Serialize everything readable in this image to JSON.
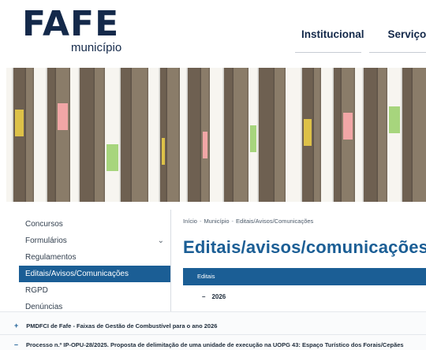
{
  "brand": {
    "name": "FAFE",
    "sub": "município"
  },
  "nav": {
    "items": [
      "Institucional",
      "Serviços"
    ]
  },
  "sidebar": {
    "items": [
      {
        "label": "Concursos"
      },
      {
        "label": "Formulários"
      },
      {
        "label": "Regulamentos"
      },
      {
        "label": "Editais/Avisos/Comunicações"
      },
      {
        "label": "RGPD"
      },
      {
        "label": "Denúncias"
      }
    ]
  },
  "breadcrumb": {
    "items": [
      "Início",
      "Município",
      "Editais/Avisos/Comunicações"
    ],
    "separator": "-"
  },
  "page": {
    "title": "Editais/avisos/comunicações"
  },
  "table": {
    "header": "Editais"
  },
  "groups": [
    {
      "toggle": "–",
      "label": "2026"
    }
  ],
  "rows": [
    {
      "toggle": "+",
      "label": "PMDFCI de Fafe - Faixas de Gestão de Combustível para o ano 2026"
    },
    {
      "toggle": "–",
      "label": "Processo n.º IP-OPU-28/2025. Proposta de delimitação de uma unidade de execução na UOPG 43: Espaço Turístico dos Forais/Cepães"
    }
  ],
  "colors": {
    "brand": "#14294a",
    "accent": "#1b5e95"
  }
}
